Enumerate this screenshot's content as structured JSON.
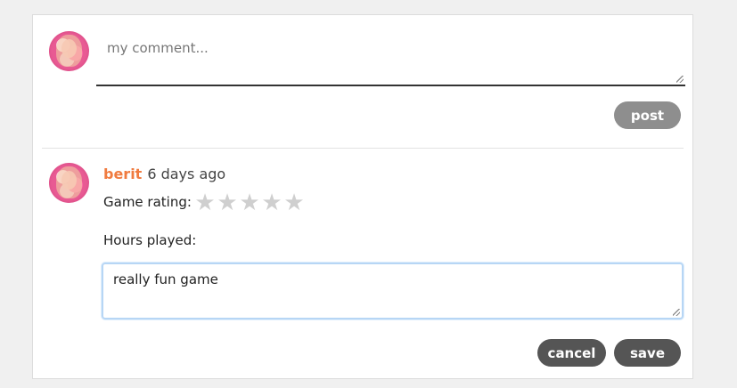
{
  "composer": {
    "placeholder": "my comment...",
    "post_label": "post"
  },
  "comment": {
    "author": "berit",
    "time": "6 days ago",
    "rating_label": "Game rating:",
    "rating_value": 0,
    "rating_max": 5,
    "hours_label": "Hours played:",
    "edit_text": "really fun game",
    "cancel_label": "cancel",
    "save_label": "save"
  },
  "colors": {
    "author": "#f07b3f",
    "post_button": "#8e8e8e",
    "action_button": "#555555",
    "star_empty": "#cfcfcf",
    "focus_border": "#b7d6f5"
  },
  "icons": {
    "star": "star-icon",
    "resize": "resize-grip-icon"
  }
}
